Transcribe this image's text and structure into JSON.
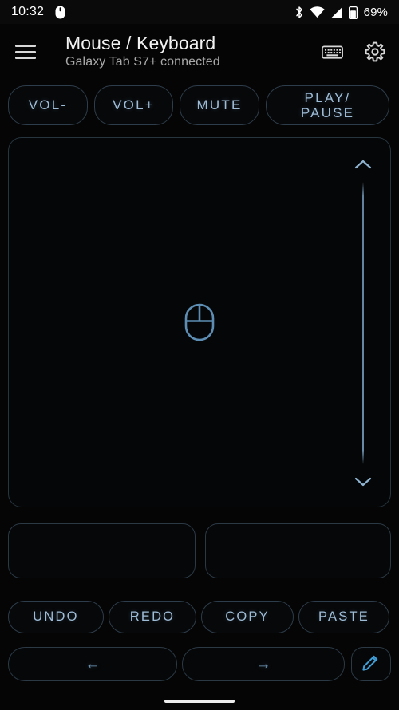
{
  "statusbar": {
    "time": "10:32",
    "mouse_icon": "mouse-icon",
    "bluetooth_icon": "bluetooth-icon",
    "wifi_icon": "wifi-icon",
    "cell_signal_icon": "cell-signal-icon",
    "battery_icon": "battery-icon",
    "battery_percent": "69%"
  },
  "appbar": {
    "menu_icon": "hamburger-menu-icon",
    "title": "Mouse / Keyboard",
    "subtitle": "Galaxy Tab S7+ connected",
    "keyboard_icon": "keyboard-icon",
    "settings_icon": "gear-icon"
  },
  "media_buttons": [
    {
      "id": "vol-down",
      "label": "VOL-"
    },
    {
      "id": "vol-up",
      "label": "VOL+"
    },
    {
      "id": "mute",
      "label": "MUTE"
    },
    {
      "id": "play-pause",
      "label": "PLAY/\nPAUSE"
    }
  ],
  "trackpad": {
    "center_icon": "mouse-icon",
    "scroll_up_icon": "chevron-up-icon",
    "scroll_down_icon": "chevron-down-icon"
  },
  "click_buttons": [
    {
      "id": "left-click",
      "label": ""
    },
    {
      "id": "right-click",
      "label": ""
    }
  ],
  "edit_buttons": [
    {
      "id": "undo",
      "label": "UNDO"
    },
    {
      "id": "redo",
      "label": "REDO"
    },
    {
      "id": "copy",
      "label": "COPY"
    },
    {
      "id": "paste",
      "label": "PASTE"
    }
  ],
  "nav_buttons": [
    {
      "id": "back",
      "label": "←"
    },
    {
      "id": "forward",
      "label": "→"
    },
    {
      "id": "pencil",
      "label": "",
      "icon": "pencil-icon"
    }
  ],
  "colors": {
    "background": "#050505",
    "accent": "#9fbcd6",
    "outline": "#2b3945",
    "pencil": "#3f9ed6",
    "title_text": "#f2f2f2",
    "subtitle_text": "#a9a9a9"
  }
}
